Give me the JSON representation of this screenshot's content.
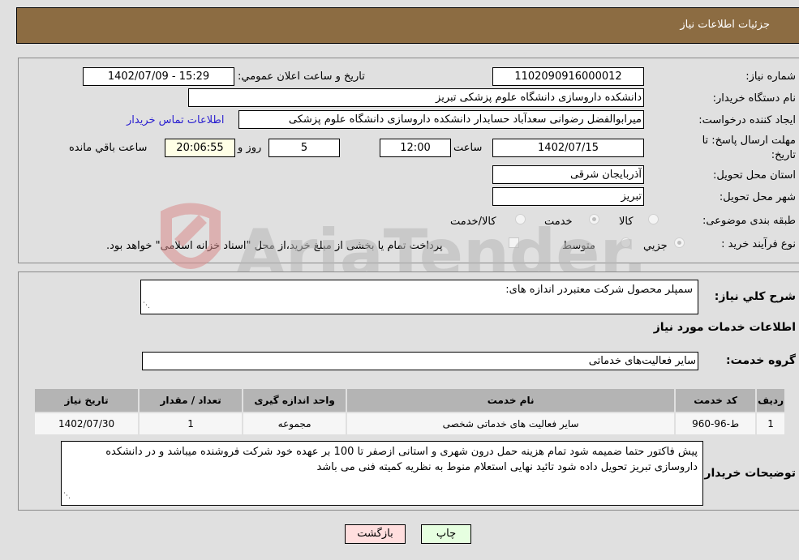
{
  "header": {
    "title": "جزئیات اطلاعات نیاز"
  },
  "form": {
    "need_number": {
      "label": "شماره نیاز:",
      "value": "1102090916000012"
    },
    "announce_datetime": {
      "label": "تاریخ و ساعت اعلان عمومي:",
      "value": "1402/07/09 - 15:29"
    },
    "buyer_org": {
      "label": "نام دستگاه خریدار:",
      "value": "دانشکده داروسازی دانشگاه علوم پزشکی تبریز"
    },
    "requester": {
      "label": "ایجاد کننده درخواست:",
      "value": "میرابوالفضل رضوانی سعدآباد حسابدار دانشکده داروسازی دانشگاه علوم پزشکی",
      "contact_link": "اطلاعات تماس خریدار"
    },
    "deadline": {
      "label": "مهلت ارسال پاسخ: تا تاریخ:",
      "date": "1402/07/15",
      "time_label": "ساعت",
      "time": "12:00",
      "days": "5",
      "days_label": "روز و",
      "remaining": "20:06:55",
      "remaining_label": "ساعت باقي مانده"
    },
    "province": {
      "label": "استان محل تحویل:",
      "value": "آذربایجان شرقی"
    },
    "city": {
      "label": "شهر محل تحویل:",
      "value": "تبریز"
    },
    "category": {
      "label": "طبقه بندی موضوعی:",
      "options": [
        "کالا",
        "خدمت",
        "کالا/خدمت"
      ],
      "selected": "خدمت"
    },
    "purchase_type": {
      "label": "نوع فرآیند خرید :",
      "options": [
        "جزیي",
        "متوسط"
      ],
      "selected": "جزیي",
      "treasury_note": "پرداخت تمام یا بخشی از مبلغ خرید،از محل \"اسناد خزانه اسلامی\" خواهد بود."
    }
  },
  "details": {
    "description_label": "شرح کلي نیاز:",
    "description": "سمپلر محصول شرکت معتبردر اندازه های:",
    "services_heading": "اطلاعات خدمات مورد نیاز",
    "service_group_label": "گروه خدمت:",
    "service_group": "سایر فعالیت‌های خدماتی",
    "table": {
      "headers": [
        "ردیف",
        "کد خدمت",
        "نام خدمت",
        "واحد اندازه گیری",
        "تعداد / مقدار",
        "تاریخ نیاز"
      ],
      "rows": [
        [
          "1",
          "ط-96-960",
          "سایر فعالیت های خدماتی شخصی",
          "مجموعه",
          "1",
          "1402/07/30"
        ]
      ]
    },
    "buyer_notes_label": "توضیحات خریدار:",
    "buyer_notes": "پیش فاکتور حتما ضمیمه شود تمام هزینه حمل درون شهری و استانی ازصفر تا 100 بر عهده خود شرکت فروشنده  میباشد و در دانشکده داروسازی تبریز تحویل داده شود تائید نهایی استعلام منوط به نظریه کمیته فنی می باشد"
  },
  "buttons": {
    "print": "چاپ",
    "back": "بازگشت"
  },
  "watermark": {
    "text": "AriaTender.neT"
  },
  "colors": {
    "header_bg": "#8c6c42",
    "link": "#2a1fd0",
    "back_btn": "#ffdede",
    "print_btn": "#e6ffe0",
    "remaining_bg": "#ffffe6"
  }
}
